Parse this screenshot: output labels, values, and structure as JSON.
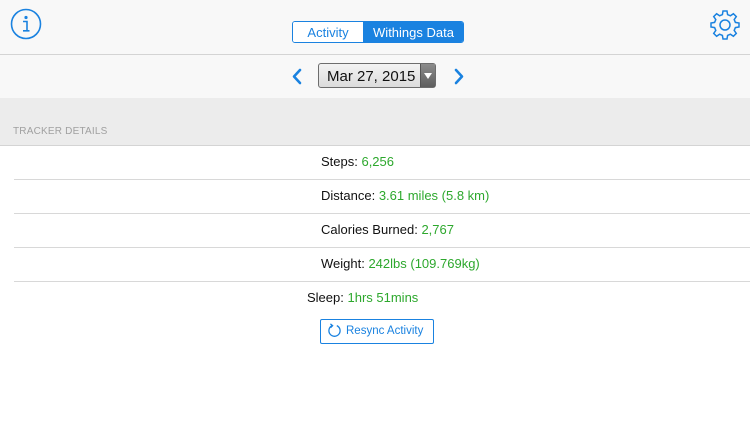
{
  "header": {
    "tabs": [
      {
        "label": "Activity"
      },
      {
        "label": "Withings Data"
      }
    ]
  },
  "date_picker": {
    "value": "Mar 27, 2015"
  },
  "section": {
    "title": "TRACKER DETAILS"
  },
  "tracker_details": [
    {
      "label": "Steps: ",
      "value": "6,256"
    },
    {
      "label": "Distance: ",
      "value": "3.61 miles (5.8 km)"
    },
    {
      "label": "Calories Burned: ",
      "value": "2,767"
    },
    {
      "label": "Weight: ",
      "value": "242lbs (109.769kg)"
    },
    {
      "label": "Sleep: ",
      "value": "1hrs 51mins"
    }
  ],
  "actions": {
    "resync_label": "Resync Activity"
  },
  "colors": {
    "accent": "#1a82e0",
    "value_green": "#2da82d",
    "section_text": "#a0a0a0"
  },
  "icons": [
    "info-icon",
    "gear-icon",
    "chevron-left-icon",
    "chevron-right-icon",
    "refresh-icon"
  ]
}
